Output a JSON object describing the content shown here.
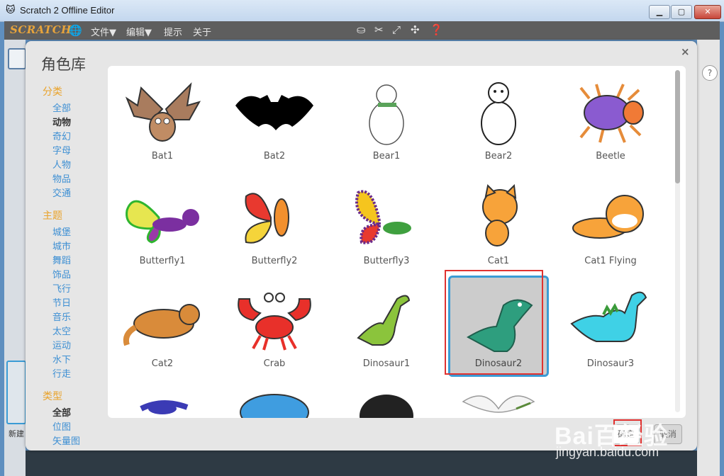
{
  "window": {
    "title": "Scratch 2 Offline Editor",
    "app_icon": "cat-icon",
    "minimize": "▁",
    "maximize": "▢",
    "close": "✕"
  },
  "menubar": {
    "logo": "SCRATCH",
    "menus": [
      "文件▼",
      "编辑▼",
      "提示",
      "关于"
    ],
    "tools": [
      "duplicate-stamp-icon",
      "delete-cut-icon",
      "grow-icon",
      "shrink-icon",
      "help-icon"
    ]
  },
  "background": {
    "new_sprite_label": "新建",
    "help_label": "?"
  },
  "dialog": {
    "title": "角色库",
    "close": "×",
    "categories": {
      "heading": "分类",
      "items": [
        "全部",
        "动物",
        "奇幻",
        "字母",
        "人物",
        "物品",
        "交通"
      ],
      "active": "动物"
    },
    "themes": {
      "heading": "主题",
      "items": [
        "城堡",
        "城市",
        "舞蹈",
        "饰品",
        "飞行",
        "节日",
        "音乐",
        "太空",
        "运动",
        "水下",
        "行走"
      ]
    },
    "types": {
      "heading": "类型",
      "items": [
        "全部",
        "位图",
        "矢量图"
      ],
      "active": "全部"
    },
    "sprites": [
      "Bat1",
      "Bat2",
      "Bear1",
      "Bear2",
      "Beetle",
      "Butterfly1",
      "Butterfly2",
      "Butterfly3",
      "Cat1",
      "Cat1 Flying",
      "Cat2",
      "Crab",
      "Dinosaur1",
      "Dinosaur2",
      "Dinosaur3"
    ],
    "selected_sprite": "Dinosaur2",
    "ok_label": "确定",
    "cancel_label": "取消"
  },
  "watermark": {
    "brand": "Bai百经验",
    "url": "jingyan.baidu.com"
  },
  "colors": {
    "category_heading": "#e9a32b",
    "category_link": "#3d8fd3",
    "selection_border": "#3a9bd5",
    "annotation_red": "#e0312f"
  }
}
